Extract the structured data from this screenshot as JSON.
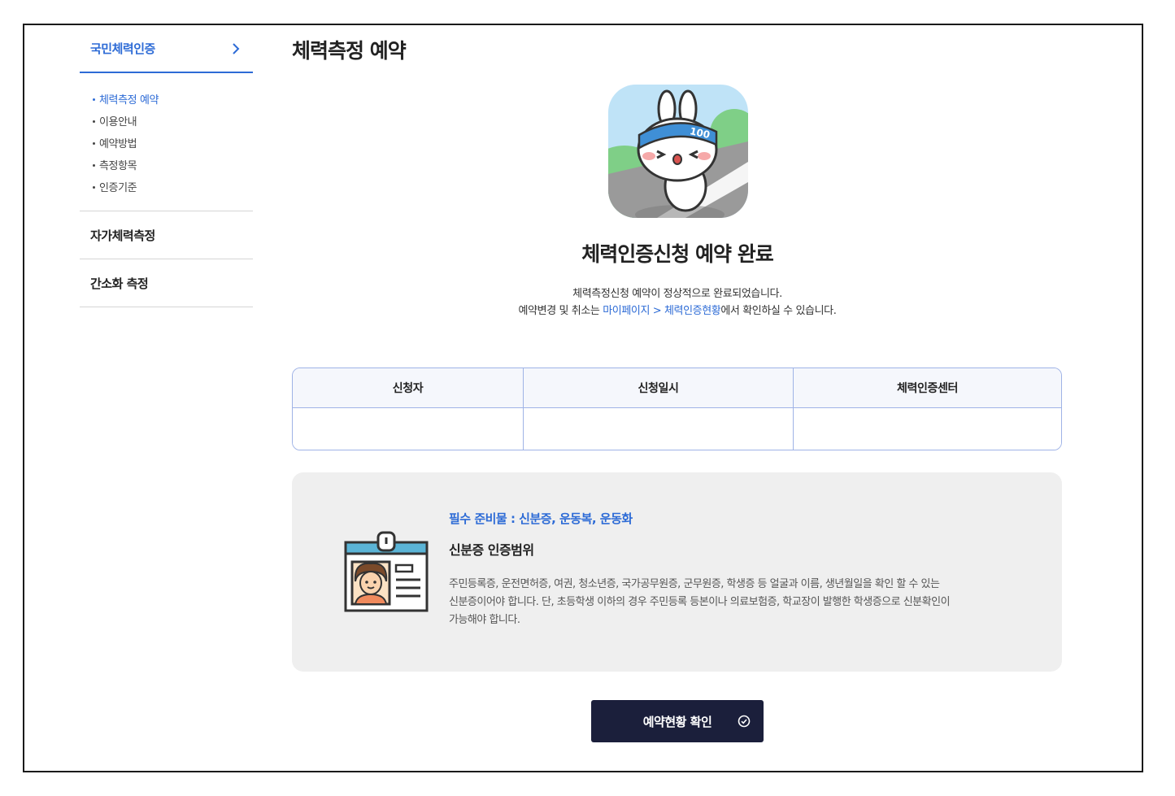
{
  "sidebar": {
    "title": "국민체력인증",
    "sub_items": [
      {
        "label": "체력측정 예약",
        "active": true
      },
      {
        "label": "이용안내",
        "active": false
      },
      {
        "label": "예약방법",
        "active": false
      },
      {
        "label": "측정항목",
        "active": false
      },
      {
        "label": "인증기준",
        "active": false
      }
    ],
    "items": [
      {
        "label": "자가체력측정"
      },
      {
        "label": "간소화 측정"
      }
    ]
  },
  "main": {
    "page_title": "체력측정 예약",
    "complete_title": "체력인증신청 예약 완료",
    "desc_line1": "체력측정신청 예약이 정상적으로 완료되었습니다.",
    "desc_line2_prefix": "예약변경 및 취소는 ",
    "desc_line2_link": "마이페이지 > 체력인증현황",
    "desc_line2_suffix": "에서 확인하실 수 있습니다.",
    "table": {
      "headers": [
        "신청자",
        "신청일시",
        "체력인증센터"
      ],
      "values": [
        "",
        "",
        ""
      ]
    },
    "notice": {
      "required": "필수 준비물 : 신분증, 운동복, 운동화",
      "range_title": "신분증 인증범위",
      "range_body_line1": "주민등록증, 운전면허증, 여권, 청소년증, 국가공무원증, 군무원증, 학생증 등 얼굴과 이름, 생년월일을 확인 할 수 있는",
      "range_body_line2": "신분증이어야 합니다. 단, 초등학생 이하의 경우 주민등록 등본이나 의료보험증, 학교장이 발행한 학생증으로 신분확인이",
      "range_body_line3": "가능해야 합니다."
    },
    "confirm_button": "예약현황 확인"
  },
  "mascot": {
    "badge_text": "100"
  },
  "colors": {
    "accent": "#2d6bd6",
    "button_bg": "#1b1f3b",
    "notice_bg": "#efefef",
    "table_border": "#9fb3e6"
  }
}
